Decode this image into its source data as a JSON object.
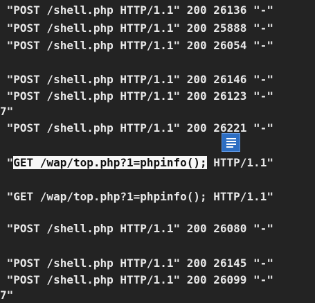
{
  "log": {
    "lines": [
      {
        "text": " \"POST /shell.php HTTP/1.1\" 200 26136 \"-\""
      },
      {
        "text": " \"POST /shell.php HTTP/1.1\" 200 25888 \"-\""
      },
      {
        "text": " \"POST /shell.php HTTP/1.1\" 200 26054 \"-\""
      },
      {
        "text": " \"POST /shell.php HTTP/1.1\" 200 26146 \"-\""
      },
      {
        "text": " \"POST /shell.php HTTP/1.1\" 200 26123 \"-\""
      },
      {
        "text": "7\""
      },
      {
        "text": " \"POST /shell.php HTTP/1.1\" 200 26221 \"-\""
      },
      {
        "pre": " \"",
        "selected": "GET /wap/top.php?1=phpinfo();",
        "post": " HTTP/1.1\""
      },
      {
        "text": " \"GET /wap/top.php?1=phpinfo(); HTTP/1.1\""
      },
      {
        "text": " \"POST /shell.php HTTP/1.1\" 200 26080 \"-\""
      },
      {
        "text": " \"POST /shell.php HTTP/1.1\" 200 26145 \"-\""
      },
      {
        "text": " \"POST /shell.php HTTP/1.1\" 200 26099 \"-\""
      },
      {
        "text": "7\""
      }
    ]
  },
  "floating_button": {
    "icon": "list-icon",
    "color": "#2d6ec2"
  },
  "theme": {
    "background": "#232323",
    "text": "#e8e8e8",
    "selection": "#f7f7f7"
  }
}
